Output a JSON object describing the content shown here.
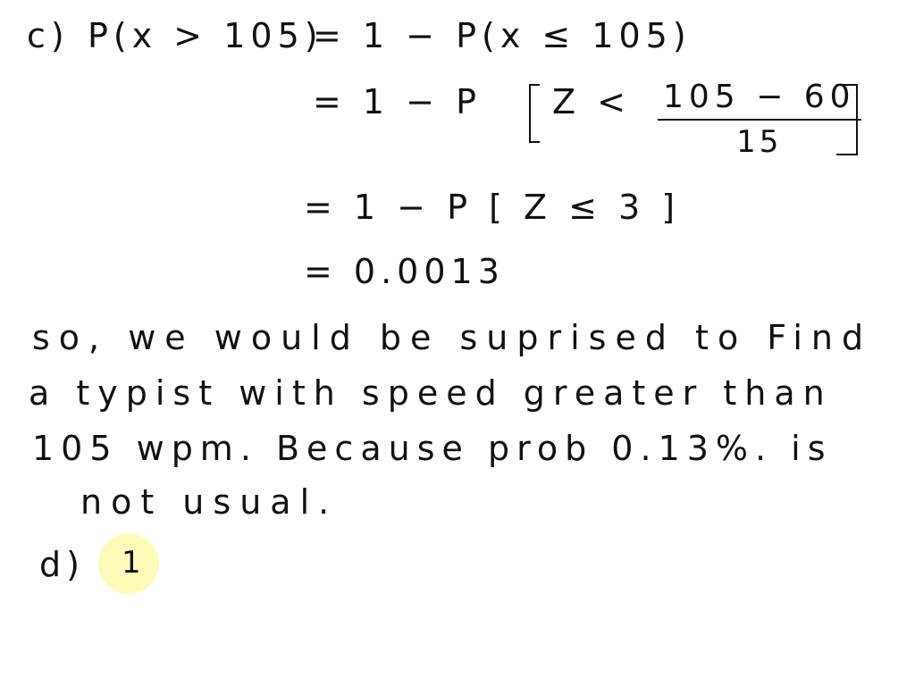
{
  "part_c": {
    "label": "c)",
    "line1_lhs": "P(x > 105)",
    "line1_rhs": "= 1 − P(x ≤ 105)",
    "line2_prefix": "= 1 − P",
    "line2_z": "Z <",
    "line2_numerator": "105 − 60",
    "line2_denominator": "15",
    "line3": "= 1 − P [ Z ≤ 3 ]",
    "line4": "= 0.0013"
  },
  "conclusion": {
    "lines": [
      "so, we would be suprised to Find",
      "a typist with speed greater than",
      "105 wpm. Because prob 0.13%. is",
      "not usual."
    ]
  },
  "part_d": {
    "label": "d)",
    "partial": "1"
  },
  "colors": {
    "ink": "#111111",
    "background": "#ffffff",
    "cursor_highlight": "#fdfbb8"
  }
}
